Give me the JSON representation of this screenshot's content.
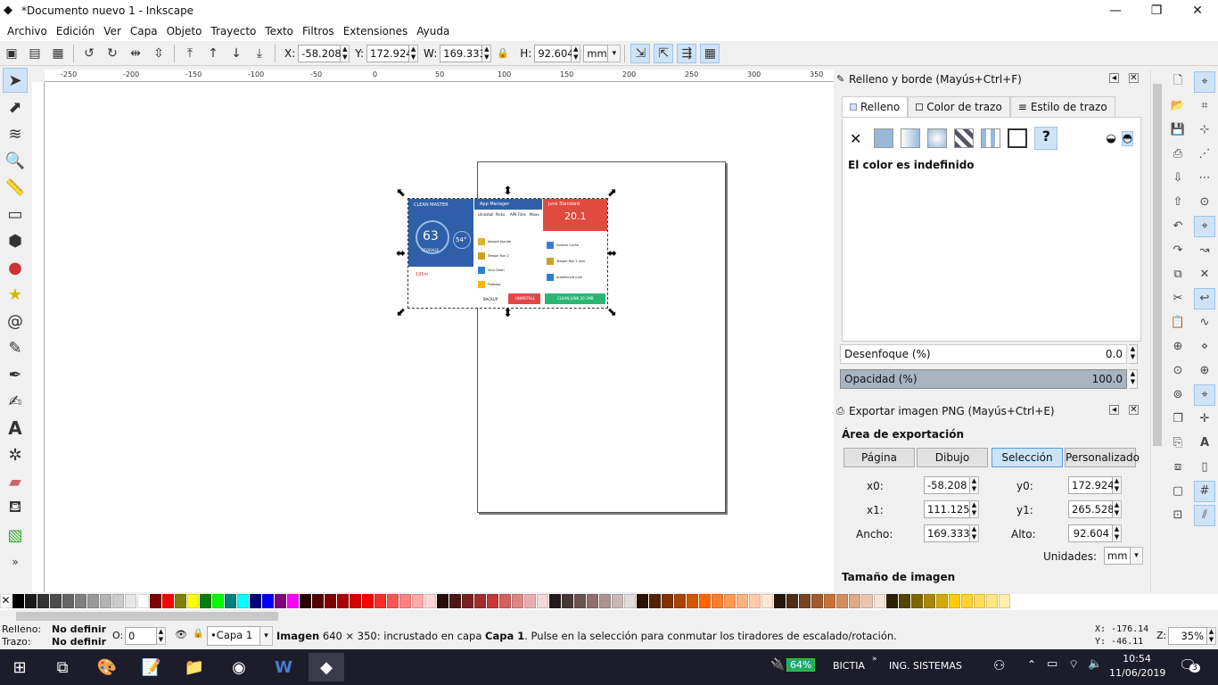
{
  "window": {
    "title": "*Documento nuevo 1 - Inkscape",
    "minimize": "—",
    "maximize": "❐",
    "close": "✕"
  },
  "menu": [
    "Archivo",
    "Edición",
    "Ver",
    "Capa",
    "Objeto",
    "Trayecto",
    "Texto",
    "Filtros",
    "Extensiones",
    "Ayuda"
  ],
  "toolbar": {
    "x_label": "X:",
    "x_value": "-58.208",
    "y_label": "Y:",
    "y_value": "172.924",
    "w_label": "W:",
    "w_value": "169.333",
    "h_label": "H:",
    "h_value": "92.604",
    "unit": "mm"
  },
  "ruler": {
    "ticks": [
      "-250",
      "-200",
      "-150",
      "-100",
      "-50",
      "0",
      "50",
      "100",
      "150",
      "200",
      "250",
      "300",
      "350"
    ]
  },
  "embedded_image": {
    "panel1_title": "CLEAN MASTER",
    "panel1_value": "63",
    "panel1_sub": "STORAGE",
    "panel1_small": "54°",
    "panel1_lower": "195m",
    "panel2_title": "App Manager",
    "panel2_tabs": [
      "Uninstall",
      "Picks",
      "APK Files",
      "Move"
    ],
    "panel2_rows": [
      "Jetpack Joyride",
      "Temple Run 2",
      "Inno Clean",
      "Firebase"
    ],
    "panel2_btn1": "BACKUP",
    "panel2_btn2": "UNINSTALL",
    "panel3_title": "Junk Standard",
    "panel3_value": "20.1",
    "panel3_rows": [
      "System Cache",
      "Temple Run 2 Junk",
      "AutoRecord Junk"
    ],
    "panel3_btn": "CLEAN JUNK 20.1MB"
  },
  "fill_panel": {
    "title": "Relleno y borde (Mayús+Ctrl+F)",
    "tabs": [
      "Relleno",
      "Color de trazo",
      "Estilo de trazo"
    ],
    "message": "El color es indefinido",
    "blur_label": "Desenfoque (%)",
    "blur_value": "0.0",
    "opacity_label": "Opacidad (%)",
    "opacity_value": "100.0"
  },
  "export_panel": {
    "title": "Exportar imagen PNG (Mayús+Ctrl+E)",
    "area_label": "Área de exportación",
    "buttons": [
      "Página",
      "Dibujo",
      "Selección",
      "Personalizado"
    ],
    "x0_label": "x0:",
    "x0_value": "-58.208",
    "y0_label": "y0:",
    "y0_value": "172.924",
    "x1_label": "x1:",
    "x1_value": "111.125",
    "y1_label": "y1:",
    "y1_value": "265.528",
    "width_label": "Ancho:",
    "width_value": "169.333",
    "height_label": "Alto:",
    "height_value": "92.604",
    "units_label": "Unidades:",
    "units_value": "mm",
    "image_size_label": "Tamaño de imagen"
  },
  "status": {
    "fill_label": "Relleno:",
    "fill_value": "No definir",
    "stroke_label": "Trazo:",
    "stroke_value": "No definir",
    "opacity_label": "O:",
    "opacity_value": "0",
    "layer": "•Capa 1",
    "message_bold": "Imagen",
    "message": " 640 × 350: incrustado en capa ",
    "message_layer": "Capa 1",
    "message_tail": ". Pulse en la selección para conmutar los tiradores de escalado/rotación.",
    "x_coord": "X: -176.14",
    "y_coord": "Y:  -46.11",
    "zoom_label": "Z:",
    "zoom_value": "35%"
  },
  "taskbar": {
    "battery": "64%",
    "network1": "BICTIA",
    "network2": "ING. SISTEMAS",
    "time": "10:54",
    "date": "11/06/2019",
    "notifications": "3"
  },
  "palette_colors": [
    "#000000",
    "#1a1a1a",
    "#333333",
    "#4d4d4d",
    "#666666",
    "#808080",
    "#999999",
    "#b3b3b3",
    "#cccccc",
    "#e6e6e6",
    "#ffffff",
    "#800000",
    "#ff0000",
    "#808000",
    "#ffff00",
    "#008000",
    "#00ff00",
    "#008080",
    "#00ffff",
    "#000080",
    "#0000ff",
    "#800080",
    "#ff00ff",
    "#2b0000",
    "#550000",
    "#800000",
    "#aa0000",
    "#d40000",
    "#ff0000",
    "#ff2a2a",
    "#ff5555",
    "#ff8080",
    "#ffaaaa",
    "#ffd5d5",
    "#280b0b",
    "#501616",
    "#782121",
    "#a02c2c",
    "#c83737",
    "#d35f5f",
    "#de8787",
    "#e9afaf",
    "#f4d7d7",
    "#241c1c",
    "#483737",
    "#6c5353",
    "#916f6f",
    "#ac9393",
    "#c8b7b7",
    "#e3dbdb",
    "#2b1100",
    "#552200",
    "#803300",
    "#aa4400",
    "#d45500",
    "#ff6600",
    "#ff7f2a",
    "#ff9955",
    "#ffb380",
    "#ffccaa",
    "#ffe6d5",
    "#28170b",
    "#502d16",
    "#784421",
    "#a05a2c",
    "#c87137",
    "#d38d5f",
    "#deaa87",
    "#e9c6af",
    "#f4e3d7",
    "#2b2200",
    "#554400",
    "#806600",
    "#aa8800",
    "#d4aa00",
    "#ffcc00",
    "#ffd42a",
    "#ffdd55",
    "#ffe680",
    "#ffeeaa"
  ],
  "colors": {
    "accent": "#cfe3f7",
    "selection_border": "#9cc4ea",
    "taskbar": "#1c1c2a"
  }
}
